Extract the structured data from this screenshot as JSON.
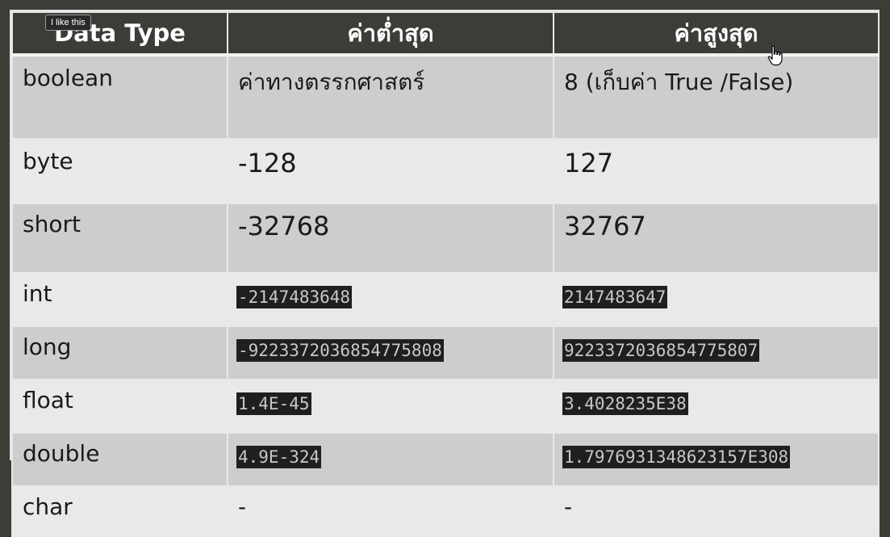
{
  "tooltip": "I like this",
  "headers": [
    "Data Type",
    "ค่าต่ำสุด",
    "ค่าสูงสุด"
  ],
  "rows": [
    {
      "type": "boolean",
      "min": "ค่าทางตรรกศาสตร์",
      "max": "8 (เก็บค่า True /False)"
    },
    {
      "type": "byte",
      "min": "-128",
      "max": "127"
    },
    {
      "type": "short",
      "min": "-32768",
      "max": "32767"
    },
    {
      "type": "int",
      "min": "-2147483648",
      "max": "2147483647"
    },
    {
      "type": "long",
      "min": "-9223372036854775808",
      "max": "9223372036854775807"
    },
    {
      "type": "float",
      "min": "1.4E-45",
      "max": "3.4028235E38"
    },
    {
      "type": "double",
      "min": "4.9E-324",
      "max": "1.7976931348623157E308"
    },
    {
      "type": "char",
      "min": "-",
      "max": "-"
    }
  ],
  "icons": {
    "cursor": "hand-pointer-icon"
  }
}
